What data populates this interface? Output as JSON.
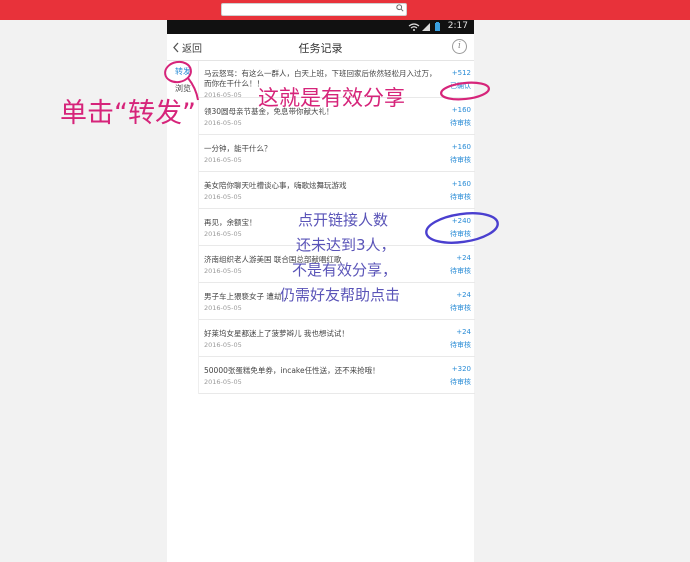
{
  "browser": {
    "search_placeholder": ""
  },
  "status_bar": {
    "time": "2:17"
  },
  "nav": {
    "back_label": "返回",
    "title": "任务记录"
  },
  "sidebar": {
    "tabs": [
      "转发",
      "浏览"
    ]
  },
  "records": [
    {
      "title": "马云怒骂：有这么一群人，白天上班，下班回家后依然轻松月入过万，而你在干什么！！",
      "date": "2016-05-05",
      "points": "+512",
      "status": "已确认"
    },
    {
      "title": "领30圆母亲节基金，免息带你献大礼！",
      "date": "2016-05-05",
      "points": "+160",
      "status": "待审核"
    },
    {
      "title": "一分钟，能干什么？",
      "date": "2016-05-05",
      "points": "+160",
      "status": "待审核"
    },
    {
      "title": "美女陪你聊天吐槽谈心事，嗨歌炫舞玩游戏",
      "date": "2016-05-05",
      "points": "+160",
      "status": "待审核"
    },
    {
      "title": "再见，余额宝！",
      "date": "2016-05-05",
      "points": "+240",
      "status": "待审核"
    },
    {
      "title": "济南组织老人游美国 联合国总部献唱红歌",
      "date": "2016-05-05",
      "points": "+24",
      "status": "待审核"
    },
    {
      "title": "男子车上猥亵女子 遭劫…",
      "date": "2016-05-05",
      "points": "+24",
      "status": "待审核"
    },
    {
      "title": "好莱坞女星都迷上了菠萝辫儿 我也想试试！",
      "date": "2016-05-05",
      "points": "+24",
      "status": "待审核"
    },
    {
      "title": "50000张蛋糕免单券，incake任性送，还不来抢哦！",
      "date": "2016-05-05",
      "points": "+320",
      "status": "待审核"
    }
  ],
  "annotations": {
    "click_forward": "单击“转发”",
    "valid_share": "这就是有效分享",
    "blue_lines": [
      "点开链接人数",
      "还未达到3人，",
      "不是有效分享，",
      "仍需好友帮助点击"
    ]
  },
  "colors": {
    "browser_bar": "#e8323a",
    "link_blue": "#2a8cd6",
    "annotation_pink": "#d6247a",
    "annotation_blue": "#5a54b8"
  }
}
